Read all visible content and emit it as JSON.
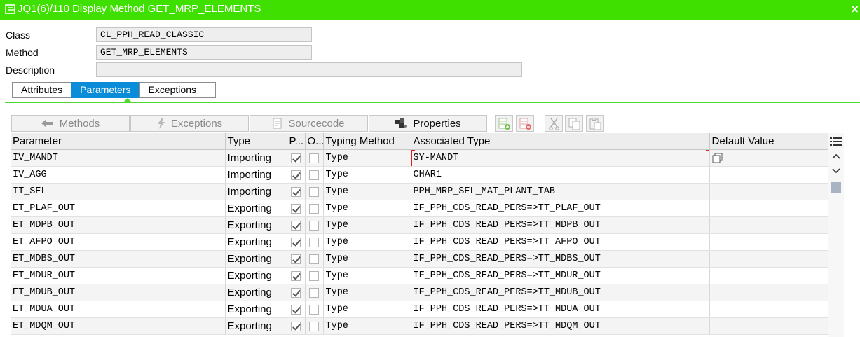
{
  "window": {
    "title": "JQ1(6)/110 Display Method GET_MRP_ELEMENTS",
    "icon": "display-document-icon",
    "close": "×"
  },
  "header": {
    "class_label": "Class",
    "class_value": "CL_PPH_READ_CLASSIC",
    "method_label": "Method",
    "method_value": "GET_MRP_ELEMENTS",
    "description_label": "Description",
    "description_value": ""
  },
  "tabs": [
    {
      "label": "Attributes",
      "active": false
    },
    {
      "label": "Parameters",
      "active": true
    },
    {
      "label": "Exceptions",
      "active": false
    }
  ],
  "toolbar": {
    "methods_label": "Methods",
    "exceptions_label": "Exceptions",
    "sourcecode_label": "Sourcecode",
    "properties_label": "Properties",
    "icons": [
      "insert-row-icon",
      "delete-row-icon",
      "cut-icon",
      "copy-icon",
      "paste-icon"
    ]
  },
  "table": {
    "columns": [
      "Parameter",
      "Type",
      "P...",
      "O...",
      "Typing Method",
      "Associated Type",
      "Default Value"
    ],
    "rows": [
      {
        "parameter": "IV_MANDT",
        "type": "Importing",
        "p": true,
        "o": false,
        "typing": "Type",
        "assoc": "SY-MANDT",
        "default": ""
      },
      {
        "parameter": "IV_AGG",
        "type": "Importing",
        "p": true,
        "o": false,
        "typing": "Type",
        "assoc": "CHAR1",
        "default": ""
      },
      {
        "parameter": "IT_SEL",
        "type": "Importing",
        "p": true,
        "o": false,
        "typing": "Type",
        "assoc": "PPH_MRP_SEL_MAT_PLANT_TAB",
        "default": ""
      },
      {
        "parameter": "ET_PLAF_OUT",
        "type": "Exporting",
        "p": true,
        "o": false,
        "typing": "Type",
        "assoc": "IF_PPH_CDS_READ_PERS=>TT_PLAF_OUT",
        "default": ""
      },
      {
        "parameter": "ET_MDPB_OUT",
        "type": "Exporting",
        "p": true,
        "o": false,
        "typing": "Type",
        "assoc": "IF_PPH_CDS_READ_PERS=>TT_MDPB_OUT",
        "default": ""
      },
      {
        "parameter": "ET_AFPO_OUT",
        "type": "Exporting",
        "p": true,
        "o": false,
        "typing": "Type",
        "assoc": "IF_PPH_CDS_READ_PERS=>TT_AFPO_OUT",
        "default": ""
      },
      {
        "parameter": "ET_MDBS_OUT",
        "type": "Exporting",
        "p": true,
        "o": false,
        "typing": "Type",
        "assoc": "IF_PPH_CDS_READ_PERS=>TT_MDBS_OUT",
        "default": ""
      },
      {
        "parameter": "ET_MDUR_OUT",
        "type": "Exporting",
        "p": true,
        "o": false,
        "typing": "Type",
        "assoc": "IF_PPH_CDS_READ_PERS=>TT_MDUR_OUT",
        "default": ""
      },
      {
        "parameter": "ET_MDUB_OUT",
        "type": "Exporting",
        "p": true,
        "o": false,
        "typing": "Type",
        "assoc": "IF_PPH_CDS_READ_PERS=>TT_MDUB_OUT",
        "default": ""
      },
      {
        "parameter": "ET_MDUA_OUT",
        "type": "Exporting",
        "p": true,
        "o": false,
        "typing": "Type",
        "assoc": "IF_PPH_CDS_READ_PERS=>TT_MDUA_OUT",
        "default": ""
      },
      {
        "parameter": "ET_MDQM_OUT",
        "type": "Exporting",
        "p": true,
        "o": false,
        "typing": "Type",
        "assoc": "IF_PPH_CDS_READ_PERS=>TT_MDQM_OUT",
        "default": ""
      }
    ]
  },
  "colors": {
    "titlebar": "#3fe000",
    "active_tab": "#0a8cd8",
    "tab_line": "#4fd830"
  }
}
